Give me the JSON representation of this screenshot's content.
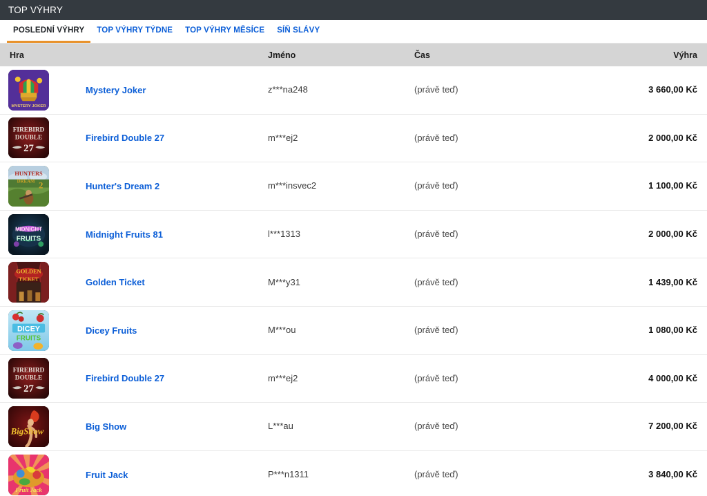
{
  "window": {
    "title": "TOP VÝHRY"
  },
  "tabs": [
    {
      "label": "POSLEDNÍ VÝHRY",
      "active": true
    },
    {
      "label": "TOP VÝHRY TÝDNE",
      "active": false
    },
    {
      "label": "TOP VÝHRY MĚSÍCE",
      "active": false
    },
    {
      "label": "SÍŇ SLÁVY",
      "active": false
    }
  ],
  "columns": {
    "game": "Hra",
    "name": "Jméno",
    "time": "Čas",
    "win": "Výhra"
  },
  "colors": {
    "titlebar_bg": "#343a40",
    "active_tab_underline": "#e8922c",
    "link_blue": "#0b5ed7",
    "column_header_bg": "#d5d5d5",
    "row_border": "#e9e9e9"
  },
  "rows": [
    {
      "game": "Mystery Joker",
      "thumb": "mystery-joker-thumbnail",
      "name": "z***na248",
      "time": "(právě teď)",
      "win": "3 660,00 Kč"
    },
    {
      "game": "Firebird Double 27",
      "thumb": "firebird-double-27-thumbnail",
      "name": "m***ej2",
      "time": "(právě teď)",
      "win": "2 000,00 Kč"
    },
    {
      "game": "Hunter's Dream 2",
      "thumb": "hunters-dream-2-thumbnail",
      "name": "m***insvec2",
      "time": "(právě teď)",
      "win": "1 100,00 Kč"
    },
    {
      "game": "Midnight Fruits 81",
      "thumb": "midnight-fruits-81-thumbnail",
      "name": "l***1313",
      "time": "(právě teď)",
      "win": "2 000,00 Kč"
    },
    {
      "game": "Golden Ticket",
      "thumb": "golden-ticket-thumbnail",
      "name": "M***y31",
      "time": "(právě teď)",
      "win": "1 439,00 Kč"
    },
    {
      "game": "Dicey Fruits",
      "thumb": "dicey-fruits-thumbnail",
      "name": "M***ou",
      "time": "(právě teď)",
      "win": "1 080,00 Kč"
    },
    {
      "game": "Firebird Double 27",
      "thumb": "firebird-double-27-thumbnail",
      "name": "m***ej2",
      "time": "(právě teď)",
      "win": "4 000,00 Kč"
    },
    {
      "game": "Big Show",
      "thumb": "big-show-thumbnail",
      "name": "L***au",
      "time": "(právě teď)",
      "win": "7 200,00 Kč"
    },
    {
      "game": "Fruit Jack",
      "thumb": "fruit-jack-thumbnail",
      "name": "P***n1311",
      "time": "(právě teď)",
      "win": "3 840,00 Kč"
    }
  ]
}
